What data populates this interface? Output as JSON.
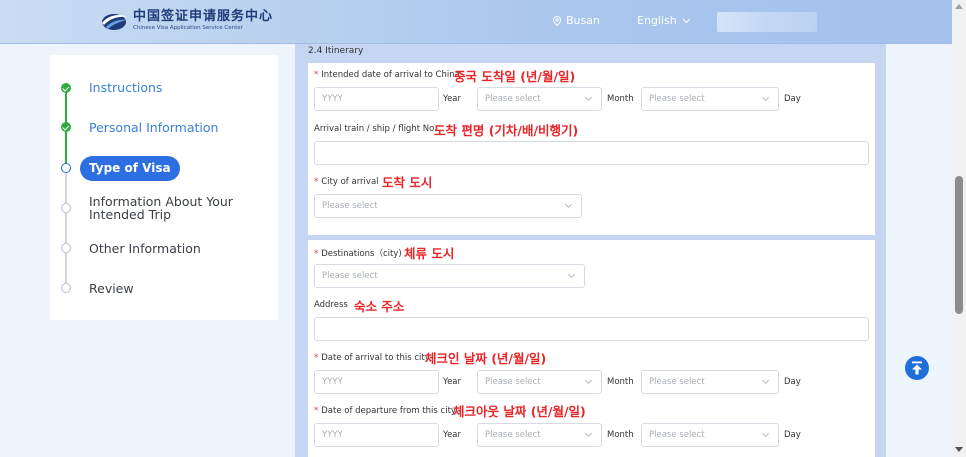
{
  "header": {
    "logo_cn": "中国签证申请服务中心",
    "logo_en": "Chinese Visa Application Service Center",
    "city": "Busan",
    "language": "English"
  },
  "sidebar": {
    "steps": [
      {
        "label": "Instructions",
        "status": "done"
      },
      {
        "label": "Personal Information",
        "status": "done"
      },
      {
        "label": "Type of Visa",
        "status": "current"
      },
      {
        "label": "Information About Your Intended Trip",
        "status": "todo"
      },
      {
        "label": "Other Information",
        "status": "todo"
      },
      {
        "label": "Review",
        "status": "todo"
      }
    ]
  },
  "form": {
    "section_title": "2.4 Itinerary",
    "arrival_date": {
      "label": "Intended date of arrival to China",
      "note": "중국 도착일 (년/월/일)",
      "year_placeholder": "YYYY",
      "year_unit": "Year",
      "month_placeholder": "Please select",
      "month_unit": "Month",
      "day_placeholder": "Please select",
      "day_unit": "Day"
    },
    "arrival_flight": {
      "label": "Arrival train / ship / flight No.",
      "note": "도착 편명 (기차/배/비행기)",
      "value": ""
    },
    "arrival_city": {
      "label": "City of arrival",
      "note": "도착 도시",
      "placeholder": "Please select"
    },
    "destination": {
      "label": "Destinations（city)",
      "note": "체류 도시",
      "placeholder": "Please select"
    },
    "address": {
      "label": "Address",
      "note": "숙소 주소",
      "value": ""
    },
    "city_arrival_date": {
      "label": "Date of arrival to this city",
      "note": "체크인 날짜 (년/월/일)",
      "year_placeholder": "YYYY",
      "year_unit": "Year",
      "month_placeholder": "Please select",
      "month_unit": "Month",
      "day_placeholder": "Please select",
      "day_unit": "Day"
    },
    "city_departure_date": {
      "label": "Date of departure from this city",
      "note": "체크아웃 날짜 (년/월/일)",
      "year_placeholder": "YYYY",
      "year_unit": "Year",
      "month_placeholder": "Please select",
      "month_unit": "Month",
      "day_placeholder": "Please select",
      "day_unit": "Day"
    }
  },
  "colors": {
    "accent": "#2d6fe0",
    "done": "#2eaa3f",
    "note_red": "#e8262a",
    "required": "#e23b3b",
    "form_bg": "#c5d5f2"
  },
  "icons": [
    "location-pin-icon",
    "chevron-down-icon",
    "check-icon",
    "scroll-to-top-icon"
  ]
}
